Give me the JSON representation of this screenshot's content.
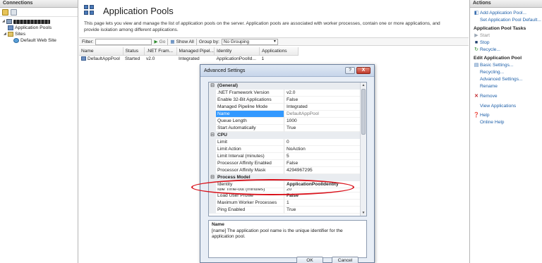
{
  "connections": {
    "header": "Connections",
    "tree": [
      "Application Pools",
      "Sites",
      "Default Web Site"
    ]
  },
  "center": {
    "title": "Application Pools",
    "description": "This page lets you view and manage the list of application pools on the server. Application pools are associated with worker processes, contain one or more applications, and provide isolation among different applications.",
    "filter_label": "Filter:",
    "go_label": "Go",
    "show_all_label": "Show All",
    "group_by_label": "Group by:",
    "group_by_value": "No Grouping",
    "columns": [
      "Name",
      "Status",
      ".NET Fram...",
      "Managed Pipel...",
      "Identity",
      "Applications"
    ],
    "rows": [
      {
        "name": "DefaultAppPool",
        "status": "Started",
        "net": "v2.0",
        "pipeline": "Integrated",
        "identity": "ApplicationPoolId...",
        "apps": "1"
      }
    ]
  },
  "dialog": {
    "title": "Advanced Settings",
    "help": "?",
    "close": "X",
    "sections": [
      {
        "label": "(General)",
        "props": [
          {
            "key": ".NET Framework Version",
            "value": "v2.0"
          },
          {
            "key": "Enable 32-Bit Applications",
            "value": "False"
          },
          {
            "key": "Managed Pipeline Mode",
            "value": "Integrated"
          },
          {
            "key": "Name",
            "value": "DefaultAppPool"
          },
          {
            "key": "Queue Length",
            "value": "1000"
          },
          {
            "key": "Start Automatically",
            "value": "True"
          }
        ]
      },
      {
        "label": "CPU",
        "props": [
          {
            "key": "Limit",
            "value": "0"
          },
          {
            "key": "Limit Action",
            "value": "NoAction"
          },
          {
            "key": "Limit Interval (minutes)",
            "value": "5"
          },
          {
            "key": "Processor Affinity Enabled",
            "value": "False"
          },
          {
            "key": "Processor Affinity Mask",
            "value": "4294967295"
          }
        ]
      },
      {
        "label": "Process Model",
        "props": [
          {
            "key": "Identity",
            "value": "ApplicationPoolIdentity"
          },
          {
            "key": "Idle Time-out (minutes)",
            "value": "20"
          },
          {
            "key": "Load User Profile",
            "value": "False"
          },
          {
            "key": "Maximum Worker Processes",
            "value": "1"
          },
          {
            "key": "Ping Enabled",
            "value": "True"
          }
        ]
      }
    ],
    "desc_name": "Name",
    "desc_text": "[name] The application pool name is the unique identifier for the application pool.",
    "ok_label": "OK",
    "cancel_label": "Cancel"
  },
  "actions": {
    "header": "Actions",
    "items_top": [
      "Add Application Pool...",
      "Set Application Pool Default..."
    ],
    "tasks_head": "Application Pool Tasks",
    "tasks": [
      "Start",
      "Stop",
      "Recycle..."
    ],
    "edit_head": "Edit Application Pool",
    "edit_items": [
      "Basic Settings...",
      "Recycling...",
      "Advanced Settings...",
      "Rename"
    ],
    "remove": "Remove",
    "view_apps": "View Applications",
    "help": "Help",
    "online_help": "Online Help"
  },
  "colors": {
    "accent": "#1d5fa8",
    "selection": "#3399ff",
    "annotation": "#d9121b"
  },
  "icons": [
    "server-icon",
    "app-pools-icon",
    "sites-icon",
    "website-icon",
    "add-icon",
    "start-icon",
    "stop-icon",
    "recycle-icon",
    "edit-icon",
    "remove-icon",
    "help-icon"
  ]
}
